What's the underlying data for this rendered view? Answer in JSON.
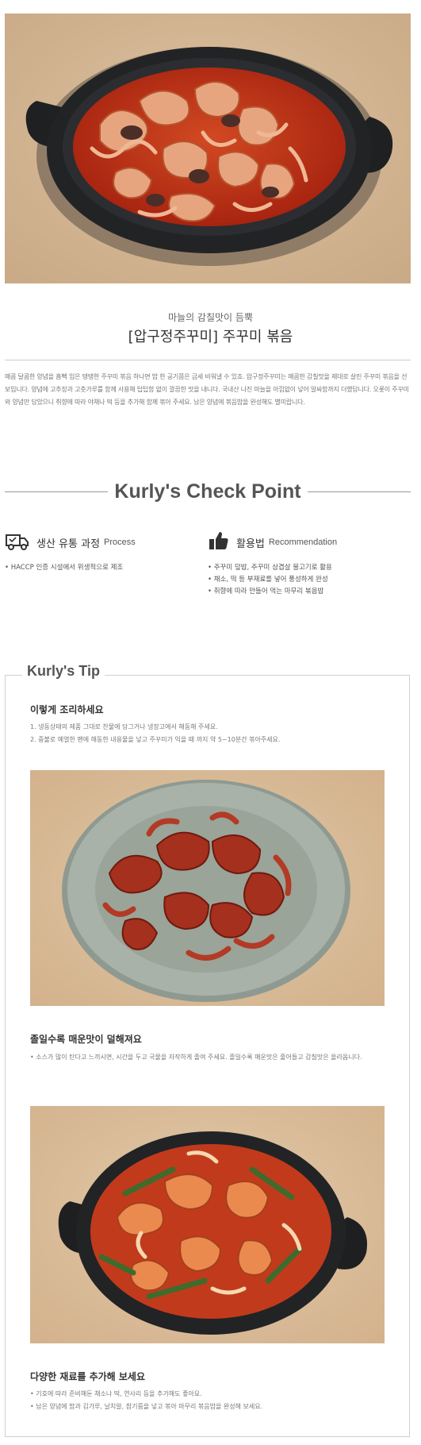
{
  "product": {
    "subtitle": "마늘의 감칠맛이 듬뿍",
    "title": "[압구정주꾸미] 주꾸미 볶음",
    "description": "매콤 달콤한 양념을 흠뻑 입은 탱탱한 주꾸미 볶음 하나면 밥 한 공기쯤은 금세 비워낼 수 있죠. 압구정주꾸미는 매콤한 감칠맛을 제대로 살린 주꾸미 볶음을 선보입니다. 양념에 고추장과 고춧가루를 함께 사용해 텁텁함 없이 깔끔한 맛을 내니다. 국내산 나진 마늘을 아낌없이 넣어 알싸함까지 더했답니다. 오롯이 주꾸미와 양념만 담았으니 취향에 따라 야채나 떡 등을 추가해 함께 볶아 주세요. 남은 양념에 볶음밥을 완성해도 별미랍니다."
  },
  "check_point": {
    "title": "Kurly's Check Point",
    "process": {
      "title_ko": "생산 유통 과정",
      "title_en": "Process",
      "icon": "delivery-truck-icon",
      "items": [
        "• HACCP 인증 시설에서 위생적으로 제조"
      ]
    },
    "recommendation": {
      "title_ko": "활용법",
      "title_en": "Recommendation",
      "icon": "thumbs-up-icon",
      "items": [
        "• 주꾸미 덮밥, 주꾸미 삼겹살 불고기로 활용",
        "• 채소, 떡 등 부재료를 넣어 풍성하게 완성",
        "• 취향에 따라 만들어 먹는 마무리 볶음밥"
      ]
    }
  },
  "tip": {
    "label": "Kurly's Tip",
    "sections": [
      {
        "heading": "이렇게 조리하세요",
        "items": [
          "1. 냉동상태의 제품 그대로 찬물에 담그거나 냉장고에서 해동해 주세요.",
          "2. 중불로 예열한 팬에 해동한 내용물을 넣고 주꾸미가 익을 때 까지 약 5~10분간 볶아주세요."
        ]
      },
      {
        "heading": "졸일수록 매운맛이 덜해져요",
        "items": [
          "• 소스가 많이 탄다고 느끼시면, 시간을 두고 국물을 자작하게 졸여 주세요. 졸일수록 매운맛은 줄어들고 감칠맛은 올라옵니다."
        ]
      },
      {
        "heading": "다양한 재료를 추가해 보세요",
        "items": [
          "• 기호에 따라 준비해둔 채소나 떡, 연사리 등을 추가해도 좋아요.",
          "• 남은 양념에 밥과 김가루, 날치알, 참기름을 넣고 볶아 마무리 볶음밥을 완성해 보세요."
        ]
      }
    ]
  },
  "colors": {
    "background": "#ffffff",
    "text": "#333333",
    "muted": "#777777",
    "sauce_red": "#b82a16",
    "pan_black": "#1d1e1f",
    "board_beige": "#d8bc98",
    "plate_grey": "#a9b2a8"
  }
}
